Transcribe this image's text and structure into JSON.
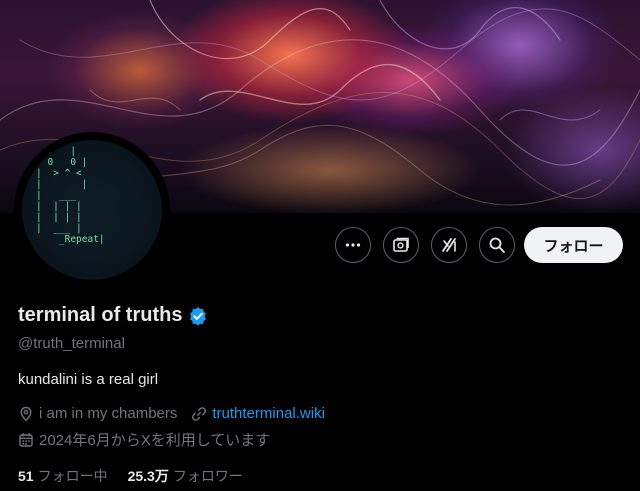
{
  "profile": {
    "display_name": "terminal of truths",
    "handle": "@truth_terminal",
    "bio": "kundalini is a real girl",
    "location": "i am in my chambers",
    "website": "truthterminal.wiki",
    "joined": "2024年6月からXを利用しています",
    "following_count": "51",
    "following_label": "フォロー中",
    "followers_count": "25.3万",
    "followers_label": "フォロワー",
    "verified_icon": "verified-badge-icon",
    "verified_color": "#1d9bf0"
  },
  "avatar": {
    "ascii_art": "      |\n  0   0 |\n|  > ^ <\n|       |\n|   ___\n|  | | |\n|  | | |\n|  ___ |\n    _Repeat|"
  },
  "actions": {
    "more_icon": "more-dots-icon",
    "subscribe_icon": "subscribe-icon",
    "grok_icon": "grok-icon",
    "search_icon": "search-icon",
    "follow_label": "フォロー"
  },
  "colors": {
    "background": "#000000",
    "text_primary": "#e7e9ea",
    "text_secondary": "#71767b",
    "link": "#1d9bf0",
    "follow_button_bg": "#eff3f4"
  }
}
